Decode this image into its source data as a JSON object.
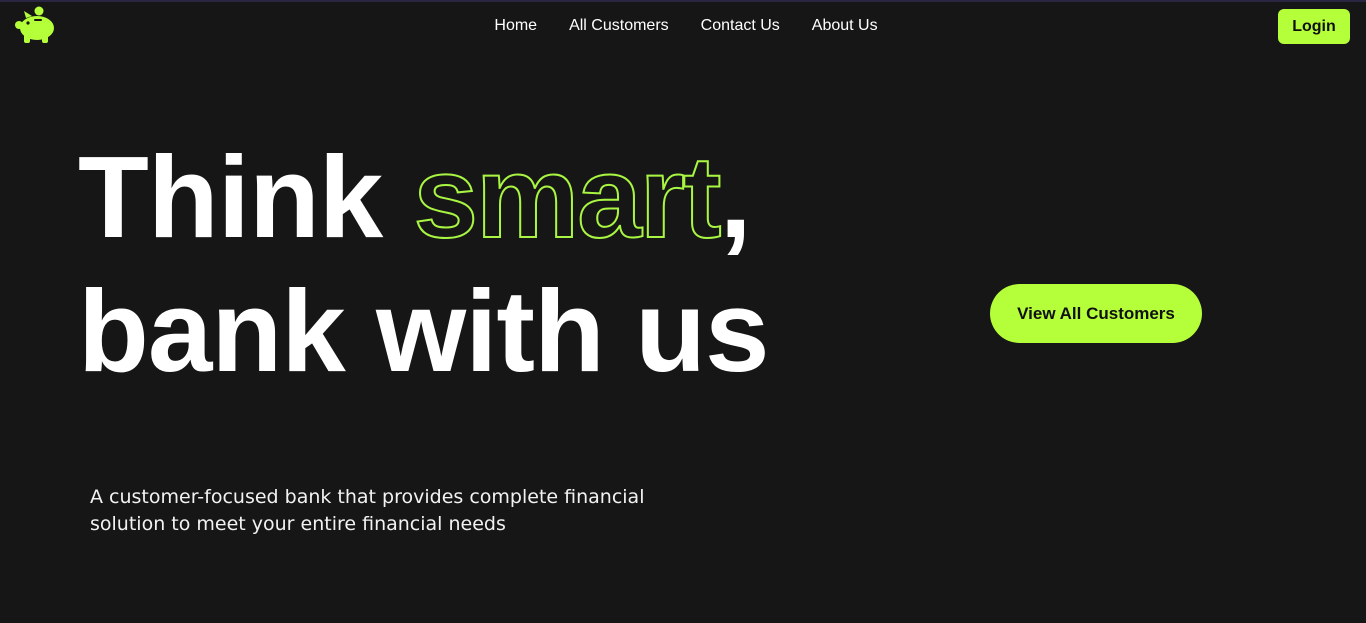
{
  "header": {
    "logo_icon": "piggy-bank-icon",
    "nav": [
      {
        "label": "Home"
      },
      {
        "label": "All Customers"
      },
      {
        "label": "Contact Us"
      },
      {
        "label": "About Us"
      }
    ],
    "login_label": "Login"
  },
  "hero": {
    "headline_part1": "Think ",
    "headline_accent": "smart",
    "headline_comma": ",",
    "headline_line2": "bank with us",
    "cta_label": "View All Customers",
    "tagline": "A customer-focused bank that provides complete financial solution to meet your entire financial needs"
  },
  "colors": {
    "background": "#161616",
    "accent": "#b4ff3a",
    "text": "#ffffff"
  }
}
